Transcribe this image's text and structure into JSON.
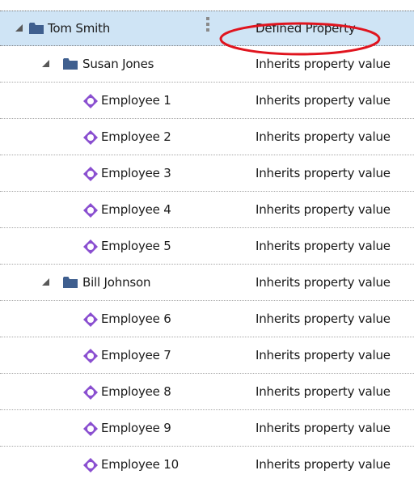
{
  "rows": [
    {
      "name": "Tom Smith",
      "value": "Defined Property",
      "type": "folder"
    },
    {
      "name": "Susan Jones",
      "value": "Inherits property value",
      "type": "folder"
    },
    {
      "name": "Employee 1",
      "value": "Inherits property value",
      "type": "employee"
    },
    {
      "name": "Employee 2",
      "value": "Inherits property value",
      "type": "employee"
    },
    {
      "name": "Employee 3",
      "value": "Inherits property value",
      "type": "employee"
    },
    {
      "name": "Employee 4",
      "value": "Inherits property value",
      "type": "employee"
    },
    {
      "name": "Employee 5",
      "value": "Inherits property value",
      "type": "employee"
    },
    {
      "name": "Bill Johnson",
      "value": "Inherits property value",
      "type": "folder"
    },
    {
      "name": "Employee 6",
      "value": "Inherits property value",
      "type": "employee"
    },
    {
      "name": "Employee 7",
      "value": "Inherits property value",
      "type": "employee"
    },
    {
      "name": "Employee 8",
      "value": "Inherits property value",
      "type": "employee"
    },
    {
      "name": "Employee 9",
      "value": "Inherits property value",
      "type": "employee"
    },
    {
      "name": "Employee 10",
      "value": "Inherits property value",
      "type": "employee"
    }
  ],
  "colors": {
    "selected_row": "#cfe4f5",
    "folder": "#3f5f8f",
    "employee_icon": "#8a4fd0",
    "highlight_ellipse": "#e0141e"
  },
  "icons": {
    "folder": "folder-icon",
    "employee": "employee-node-icon",
    "expander": "expand-triangle-icon"
  }
}
